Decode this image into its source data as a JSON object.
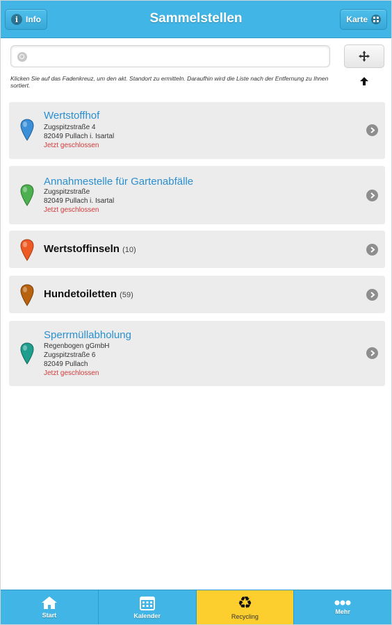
{
  "header": {
    "title": "Sammelstellen",
    "info_label": "Info",
    "karte_label": "Karte"
  },
  "search": {
    "placeholder": "",
    "value": ""
  },
  "hint": "Klicken Sie auf das Fadenkreuz, um den akt. Standort zu ermitteln. Daraufhin wird die Liste nach der Entfernung zu Ihnen sortiert.",
  "list": [
    {
      "title": "Wertstoffhof",
      "lines": [
        "Zugspitzstraße 4",
        "82049 Pullach i. Isartal"
      ],
      "status": "Jetzt geschlossen",
      "pin_color": "#3a8fd6"
    },
    {
      "title": "Annahmestelle für Gartenabfälle",
      "lines": [
        "Zugspitzstraße",
        "82049 Pullach i. Isartal"
      ],
      "status": "Jetzt geschlossen",
      "pin_color": "#4caf50"
    },
    {
      "title": "Wertstoffinseln",
      "count": "(10)",
      "pin_color": "#ee5a24"
    },
    {
      "title": "Hundetoiletten",
      "count": "(59)",
      "pin_color": "#b8610f"
    },
    {
      "title": "Sperrmüllabholung",
      "lines": [
        "Regenbogen gGmbH",
        "Zugspitzstraße 6",
        "82049 Pullach"
      ],
      "status": "Jetzt geschlossen",
      "pin_color": "#1f9e8e"
    }
  ],
  "tabs": [
    {
      "label": "Start",
      "icon": "home-icon"
    },
    {
      "label": "Kalender",
      "icon": "calendar-icon"
    },
    {
      "label": "Recycling",
      "icon": "recycle-icon",
      "active": true
    },
    {
      "label": "Mehr",
      "icon": "more-icon"
    }
  ],
  "colors": {
    "accent": "#41b6e6",
    "active_tab": "#fccf2f",
    "status_closed": "#d23b3b",
    "link": "#2a8fd0"
  }
}
